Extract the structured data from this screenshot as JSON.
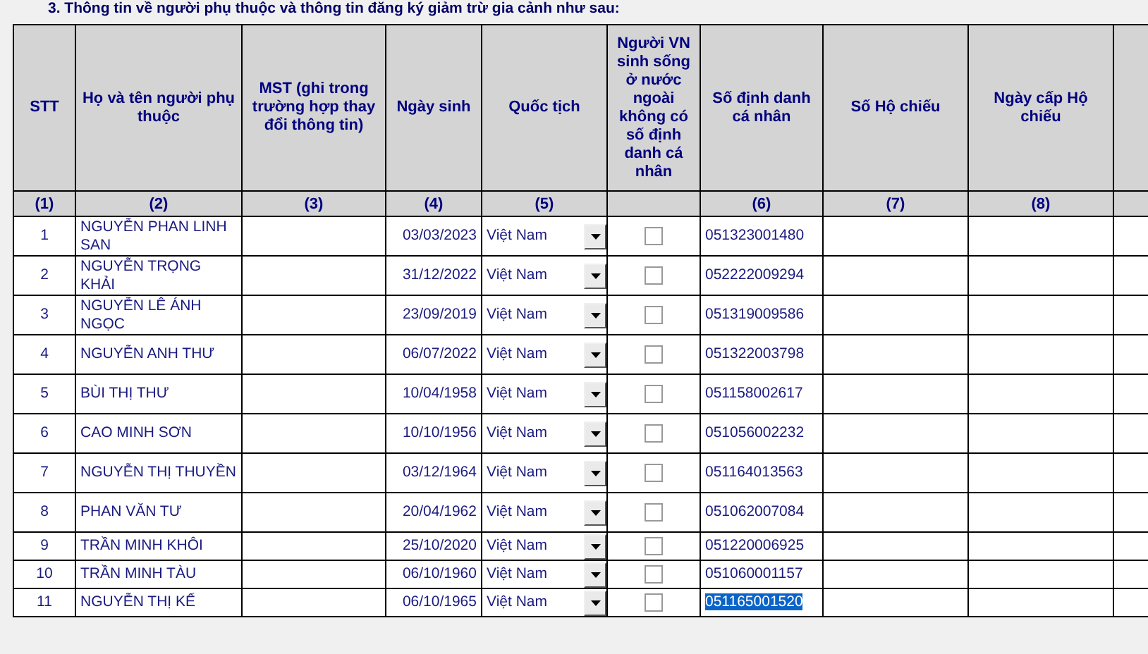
{
  "section_title": "3. Thông tin về người phụ thuộc và thông tin đăng ký giảm trừ gia cảnh như sau:",
  "table": {
    "columns": [
      {
        "header": "STT",
        "number": "(1)"
      },
      {
        "header": "Họ và tên người phụ thuộc",
        "number": "(2)"
      },
      {
        "header": "MST (ghi trong trường hợp thay đổi thông tin)",
        "number": "(3)"
      },
      {
        "header": "Ngày sinh",
        "number": "(4)"
      },
      {
        "header": "Quốc tịch",
        "number": "(5)"
      },
      {
        "header": "Người VN sinh sống ở nước ngoài không có số định danh cá nhân"
      },
      {
        "header": "Số định danh cá nhân",
        "number": "(6)"
      },
      {
        "header": "Số Hộ chiếu",
        "number": "(7)"
      },
      {
        "header": "Ngày cấp Hộ chiếu",
        "number": "(8)"
      }
    ],
    "rows": [
      {
        "stt": "1",
        "name": "NGUYỄN PHAN LINH SAN",
        "dob": "03/03/2023",
        "nationality": "Việt Nam",
        "abroad_checked": false,
        "id_number": "051323001480",
        "id_selected": false
      },
      {
        "stt": "2",
        "name": "NGUYỄN TRỌNG KHẢI",
        "dob": "31/12/2022",
        "nationality": "Việt Nam",
        "abroad_checked": false,
        "id_number": "052222009294",
        "id_selected": false
      },
      {
        "stt": "3",
        "name": "NGUYỄN LÊ ÁNH NGỌC",
        "dob": "23/09/2019",
        "nationality": "Việt Nam",
        "abroad_checked": false,
        "id_number": "051319009586",
        "id_selected": false
      },
      {
        "stt": "4",
        "name": "NGUYỄN ANH THƯ",
        "dob": "06/07/2022",
        "nationality": "Việt Nam",
        "abroad_checked": false,
        "id_number": "051322003798",
        "id_selected": false
      },
      {
        "stt": "5",
        "name": "BÙI THỊ THƯ",
        "dob": "10/04/1958",
        "nationality": "Việt Nam",
        "abroad_checked": false,
        "id_number": "051158002617",
        "id_selected": false
      },
      {
        "stt": "6",
        "name": "CAO MINH SƠN",
        "dob": "10/10/1956",
        "nationality": "Việt Nam",
        "abroad_checked": false,
        "id_number": "051056002232",
        "id_selected": false
      },
      {
        "stt": "7",
        "name": "NGUYỄN THỊ THUYỀN",
        "dob": "03/12/1964",
        "nationality": "Việt Nam",
        "abroad_checked": false,
        "id_number": "051164013563",
        "id_selected": false
      },
      {
        "stt": "8",
        "name": "PHAN VĂN TƯ",
        "dob": "20/04/1962",
        "nationality": "Việt Nam",
        "abroad_checked": false,
        "id_number": "051062007084",
        "id_selected": false
      },
      {
        "stt": "9",
        "name": "TRẦN MINH KHÔI",
        "dob": "25/10/2020",
        "nationality": "Việt Nam",
        "abroad_checked": false,
        "id_number": "051220006925",
        "id_selected": false
      },
      {
        "stt": "10",
        "name": "TRẦN MINH TÀU",
        "dob": "06/10/1960",
        "nationality": "Việt Nam",
        "abroad_checked": false,
        "id_number": "051060001157",
        "id_selected": false
      },
      {
        "stt": "11",
        "name": "NGUYỄN THỊ KẾ",
        "dob": "06/10/1965",
        "nationality": "Việt Nam",
        "abroad_checked": false,
        "id_number": "051165001520",
        "id_selected": true
      }
    ]
  }
}
